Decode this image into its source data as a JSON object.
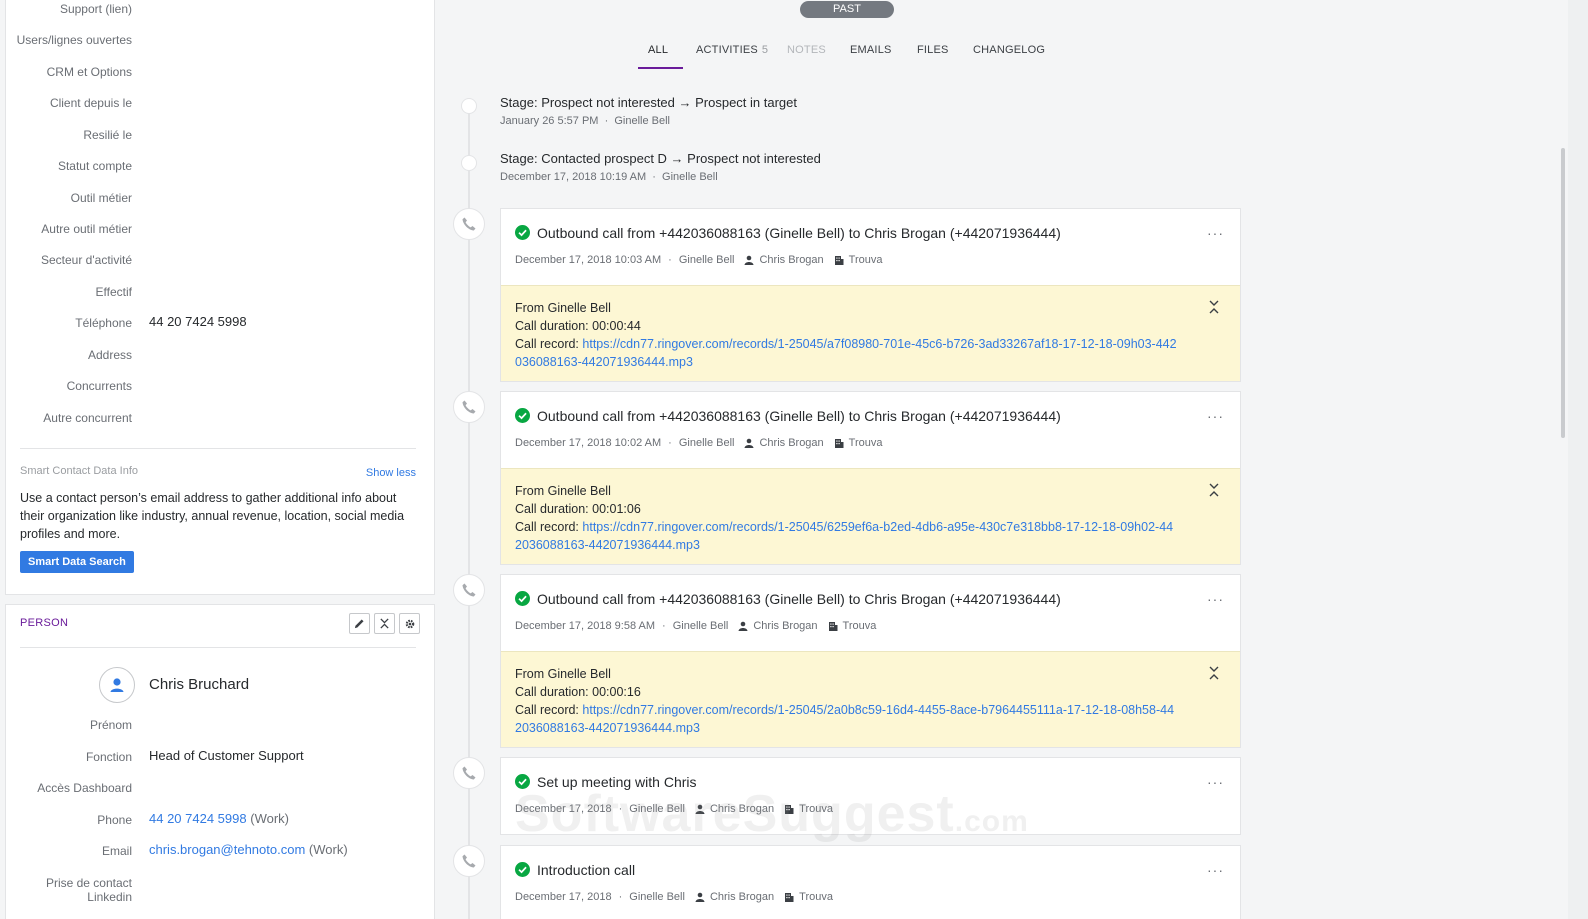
{
  "sidebar": {
    "fields": [
      {
        "label": "Support (lien)",
        "value": ""
      },
      {
        "label": "Users/lignes ouvertes",
        "value": ""
      },
      {
        "label": "CRM et Options",
        "value": ""
      },
      {
        "label": "Client depuis le",
        "value": ""
      },
      {
        "label": "Resilié le",
        "value": ""
      },
      {
        "label": "Statut compte",
        "value": ""
      },
      {
        "label": "Outil métier",
        "value": ""
      },
      {
        "label": "Autre outil métier",
        "value": ""
      },
      {
        "label": "Secteur d'activité",
        "value": ""
      },
      {
        "label": "Effectif",
        "value": ""
      },
      {
        "label": "Téléphone",
        "value": "44 20 7424 5998"
      },
      {
        "label": "Address",
        "value": ""
      },
      {
        "label": "Concurrents",
        "value": ""
      },
      {
        "label": "Autre concurrent",
        "value": ""
      }
    ],
    "smart": {
      "title": "Smart Contact Data Info",
      "toggle": "Show less",
      "text": "Use a contact person’s email address to gather additional info about their organization like industry, annual revenue, location, social media profiles and more.",
      "button": "Smart Data Search"
    },
    "person": {
      "title": "PERSON",
      "name": "Chris Bruchard",
      "fields": [
        {
          "label": "Prénom",
          "value": ""
        },
        {
          "label": "Fonction",
          "value": "Head of Customer Support"
        },
        {
          "label": "Accès Dashboard",
          "value": ""
        },
        {
          "label": "Phone",
          "value": "44 20 7424 5998",
          "suffix": "(Work)"
        },
        {
          "label": "Email",
          "value": "chris.brogan@tehnoto.com",
          "suffix": "(Work)"
        },
        {
          "label": "Prise de contact",
          "label2": "Linkedin",
          "value": ""
        }
      ]
    }
  },
  "timeline": {
    "pill": "PAST",
    "tabs": [
      {
        "label": "ALL"
      },
      {
        "label": "ACTIVITIES",
        "count": "5"
      },
      {
        "label": "NOTES"
      },
      {
        "label": "EMAILS"
      },
      {
        "label": "FILES"
      },
      {
        "label": "CHANGELOG"
      }
    ],
    "stages": [
      {
        "text": "Stage: Prospect not interested → Prospect in target",
        "date": "January 26 5:57 PM",
        "user": "Ginelle Bell"
      },
      {
        "text": "Stage: Contacted prospect D → Prospect not interested",
        "date": "December 17, 2018 10:19 AM",
        "user": "Ginelle Bell"
      }
    ],
    "activities": [
      {
        "title": "Outbound call from +442036088163 (Ginelle Bell) to Chris Brogan (+442071936444)",
        "date": "December 17, 2018 10:03 AM",
        "user": "Ginelle Bell",
        "person": "Chris Brogan",
        "org": "Trouva",
        "from": "From Ginelle Bell",
        "duration": "Call duration: 00:00:44",
        "record_label": "Call record:",
        "record_url": "https://cdn77.ringover.com/records/1-25045/a7f08980-701e-45c6-b726-3ad33267af18-17-12-18-09h03-442036088163-442071936444.mp3"
      },
      {
        "title": "Outbound call from +442036088163 (Ginelle Bell) to Chris Brogan (+442071936444)",
        "date": "December 17, 2018 10:02 AM",
        "user": "Ginelle Bell",
        "person": "Chris Brogan",
        "org": "Trouva",
        "from": "From Ginelle Bell",
        "duration": "Call duration: 00:01:06",
        "record_label": "Call record:",
        "record_url": "https://cdn77.ringover.com/records/1-25045/6259ef6a-b2ed-4db6-a95e-430c7e318bb8-17-12-18-09h02-442036088163-442071936444.mp3"
      },
      {
        "title": "Outbound call from +442036088163 (Ginelle Bell) to Chris Brogan (+442071936444)",
        "date": "December 17, 2018 9:58 AM",
        "user": "Ginelle Bell",
        "person": "Chris Brogan",
        "org": "Trouva",
        "from": "From Ginelle Bell",
        "duration": "Call duration: 00:00:16",
        "record_label": "Call record:",
        "record_url": "https://cdn77.ringover.com/records/1-25045/2a0b8c59-16d4-4455-8ace-b7964455111a-17-12-18-08h58-442036088163-442071936444.mp3"
      },
      {
        "title": "Set up meeting with Chris",
        "date": "December 17, 2018",
        "user": "Ginelle Bell",
        "person": "Chris Brogan",
        "org": "Trouva"
      },
      {
        "title": "Introduction call",
        "date": "December 17, 2018",
        "user": "Ginelle Bell",
        "person": "Chris Brogan",
        "org": "Trouva"
      }
    ],
    "more_glyph": "···",
    "watermark": "SoftwareSuggest",
    "watermark_suffix": ".com"
  },
  "colors": {
    "accent": "#6a1b9a",
    "link": "#317ae2",
    "success": "#08a742",
    "note_bg": "#fdf7d4"
  }
}
